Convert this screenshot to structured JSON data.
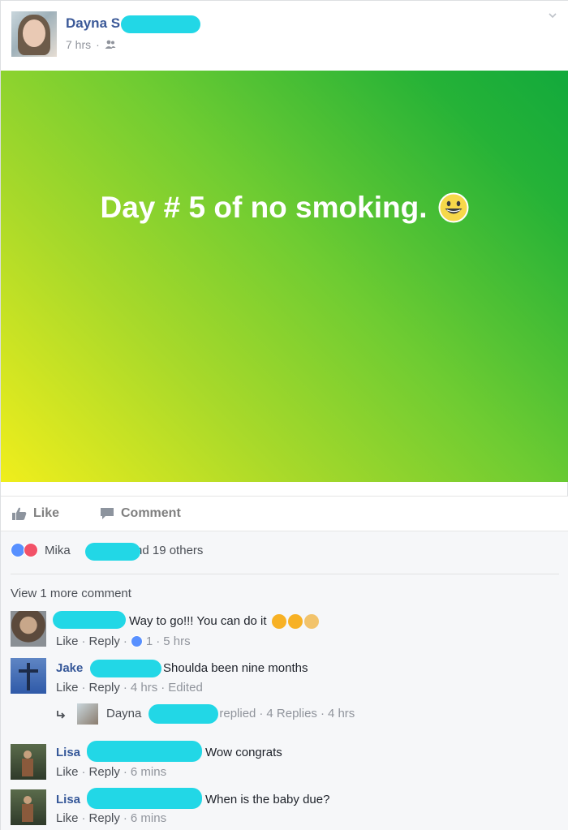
{
  "post": {
    "author_name": "Dayna S",
    "time": "7 hrs",
    "audience_icon": "friends-icon",
    "status_text": "Day # 5 of no smoking.",
    "status_emoji": "grinning-face-emoji"
  },
  "actions": {
    "like_label": "Like",
    "comment_label": "Comment"
  },
  "reactions": {
    "first_name": "Mika",
    "others_text": "and 19 others"
  },
  "comments_section": {
    "view_more": "View 1 more comment",
    "comments": [
      {
        "name": "",
        "text": "Way to go!!! You can do it",
        "like": "Like",
        "reply": "Reply",
        "like_count": "1",
        "time": "5 hrs"
      },
      {
        "name": "Jake",
        "text": "Shoulda been nine months",
        "like": "Like",
        "reply": "Reply",
        "time": "4 hrs",
        "edited": "Edited"
      },
      {
        "name": "Lisa",
        "text": "Wow congrats",
        "like": "Like",
        "reply": "Reply",
        "time": "6 mins"
      },
      {
        "name": "Lisa",
        "text": "When is the baby due?",
        "like": "Like",
        "reply": "Reply",
        "time": "6 mins"
      }
    ],
    "reply_summary": {
      "name": "Dayna",
      "replied": "replied",
      "replies": "4 Replies",
      "time": "4 hrs"
    }
  },
  "colors": {
    "link_blue": "#365899",
    "redaction": "#22d7e6",
    "meta_gray": "#90949c"
  }
}
